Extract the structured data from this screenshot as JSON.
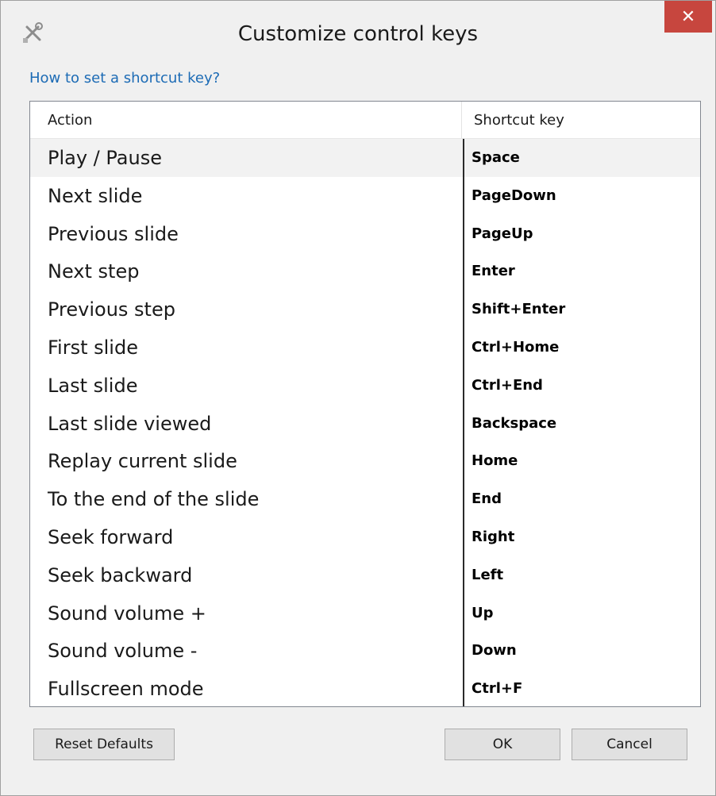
{
  "window": {
    "title": "Customize control keys",
    "close_glyph": "✕",
    "app_icon": "tools-icon"
  },
  "help_link": "How to set a shortcut key?",
  "table": {
    "columns": [
      "Action",
      "Shortcut key"
    ],
    "rows": [
      {
        "action": "Play / Pause",
        "key": "Space"
      },
      {
        "action": "Next slide",
        "key": "PageDown"
      },
      {
        "action": "Previous slide",
        "key": "PageUp"
      },
      {
        "action": "Next step",
        "key": "Enter"
      },
      {
        "action": "Previous step",
        "key": "Shift+Enter"
      },
      {
        "action": "First slide",
        "key": "Ctrl+Home"
      },
      {
        "action": "Last slide",
        "key": "Ctrl+End"
      },
      {
        "action": "Last slide viewed",
        "key": "Backspace"
      },
      {
        "action": "Replay current slide",
        "key": "Home"
      },
      {
        "action": "To the end of the slide",
        "key": "End"
      },
      {
        "action": "Seek forward",
        "key": "Right"
      },
      {
        "action": "Seek backward",
        "key": "Left"
      },
      {
        "action": "Sound volume +",
        "key": "Up"
      },
      {
        "action": "Sound volume -",
        "key": "Down"
      },
      {
        "action": "Fullscreen mode",
        "key": "Ctrl+F"
      }
    ]
  },
  "buttons": {
    "reset": "Reset Defaults",
    "ok": "OK",
    "cancel": "Cancel"
  },
  "colors": {
    "close_button": "#c7463e",
    "link": "#1c6bb5",
    "window_bg": "#f0f0f0"
  }
}
